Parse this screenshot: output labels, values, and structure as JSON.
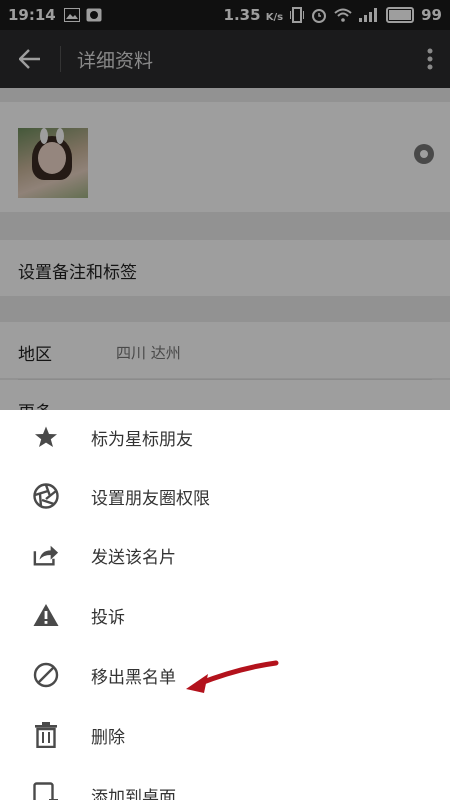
{
  "statusbar": {
    "time": "19:14",
    "speed": "1.35",
    "speed_unit": "K/s",
    "battery": "99"
  },
  "header": {
    "title": "详细资料"
  },
  "profile": {
    "remark_row": "设置备注和标签",
    "region_label": "地区",
    "region_value": "四川  达州",
    "more_label": "更多"
  },
  "menu": {
    "items": [
      {
        "label": "标为星标朋友",
        "icon": "star-icon"
      },
      {
        "label": "设置朋友圈权限",
        "icon": "aperture-icon"
      },
      {
        "label": "发送该名片",
        "icon": "share-icon"
      },
      {
        "label": "投诉",
        "icon": "warning-icon"
      },
      {
        "label": "移出黑名单",
        "icon": "block-icon"
      },
      {
        "label": "删除",
        "icon": "trash-icon"
      },
      {
        "label": "添加到桌面",
        "icon": "add-to-desktop-icon"
      }
    ]
  },
  "colors": {
    "icon": "#4a4a4a",
    "annotation_arrow": "#b3121c",
    "titlebar": "#2c2c2e"
  }
}
